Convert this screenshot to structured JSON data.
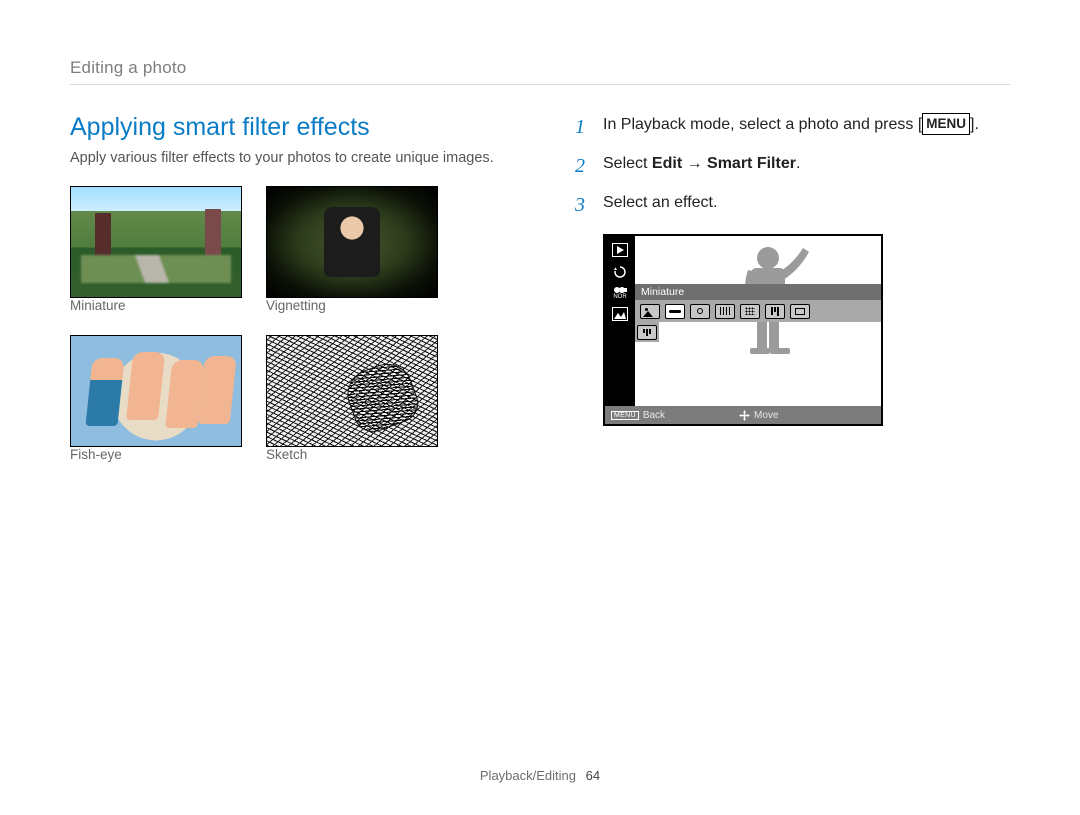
{
  "breadcrumb": "Editing a photo",
  "section_title": "Applying smart filter effects",
  "intro": "Apply various filter effects to your photos to create unique images.",
  "thumbs": {
    "miniature": "Miniature",
    "vignetting": "Vignetting",
    "fisheye": "Fish-eye",
    "sketch": "Sketch"
  },
  "steps": {
    "s1_pre": "In Playback mode, select a photo and press [",
    "s1_key": "MENU",
    "s1_post": "].",
    "s2_pre": "Select ",
    "s2_bold": "Edit → Smart Filter",
    "s2_post": ".",
    "s3": "Select an effect."
  },
  "lcd": {
    "selected_label": "Miniature",
    "footer_back": "Back",
    "footer_move": "Move",
    "footer_menu_tag": "MENU"
  },
  "footer": {
    "section": "Playback/Editing",
    "page": "64"
  }
}
